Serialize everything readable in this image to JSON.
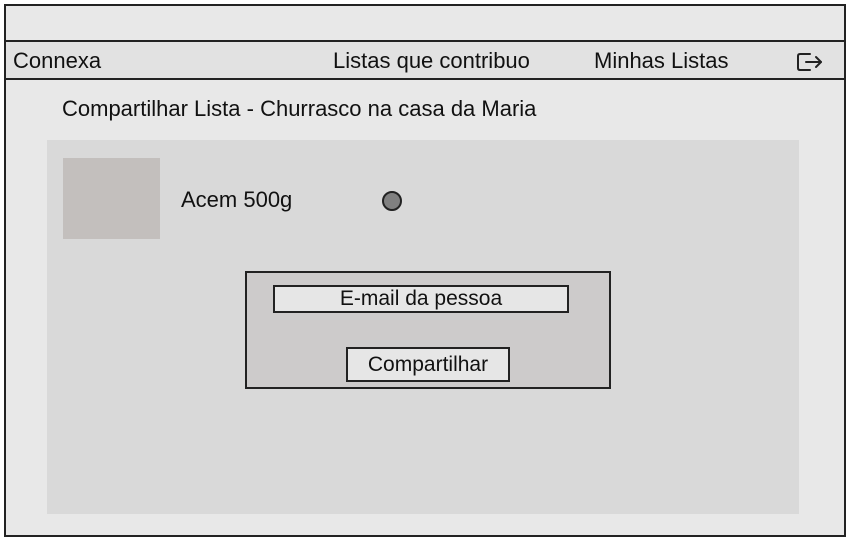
{
  "navbar": {
    "brand": "Connexa",
    "links": [
      {
        "label": "Listas que contribuo"
      },
      {
        "label": "Minhas Listas"
      }
    ],
    "logout_icon": "logout-icon"
  },
  "page": {
    "title": "Compartilhar Lista - Churrasco na casa da Maria"
  },
  "item": {
    "name": "Acem 500g",
    "image_icon": "image-placeholder",
    "status_icon": "status-dot"
  },
  "share_dialog": {
    "email_placeholder": "E-mail da pessoa",
    "email_value": "",
    "button_label": "Compartilhar"
  },
  "colors": {
    "background": "#e8e8e8",
    "navbar": "#e2e2e2",
    "panel": "#d9d9d9",
    "dialog": "#cdcbcb",
    "thumbnail": "#c3bfbd",
    "status_dot": "#808080",
    "border": "#222222"
  }
}
